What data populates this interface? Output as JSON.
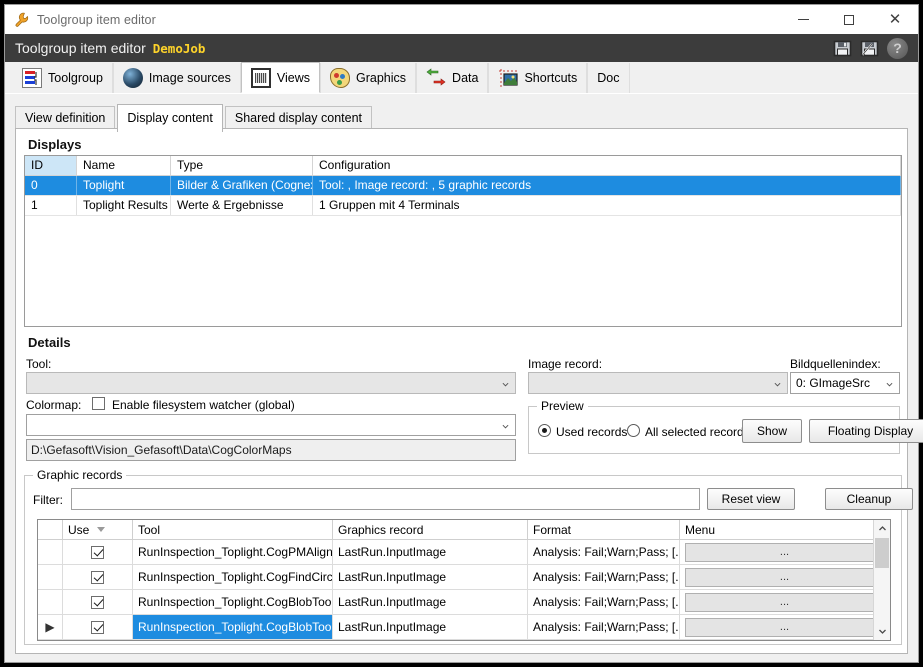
{
  "window": {
    "title": "Toolgroup item editor",
    "icon": "wrench-icon",
    "minimize_label": "Minimize",
    "maximize_label": "Maximize",
    "close_label": "Close"
  },
  "header": {
    "title": "Toolgroup item editor",
    "job_name": "DemoJob",
    "icons": [
      "save-icon",
      "save-as-icon",
      "help-icon"
    ],
    "help_glyph": "?",
    "job_color": "#ffd42a",
    "background_color": "#3c3c3c"
  },
  "toolbar": {
    "tabs": [
      {
        "label": "Toolgroup",
        "icon": "toolgroup-icon",
        "active": false
      },
      {
        "label": "Image sources",
        "icon": "image-sources-icon",
        "active": false
      },
      {
        "label": "Views",
        "icon": "views-icon",
        "active": true
      },
      {
        "label": "Graphics",
        "icon": "graphics-icon",
        "active": false
      },
      {
        "label": "Data",
        "icon": "data-icon",
        "active": false
      },
      {
        "label": "Shortcuts",
        "icon": "shortcuts-icon",
        "active": false
      },
      {
        "label": "Doc",
        "icon": "",
        "active": false
      }
    ]
  },
  "subtabs": [
    {
      "label": "View definition",
      "active": false
    },
    {
      "label": "Display content",
      "active": true
    },
    {
      "label": "Shared display content",
      "active": false
    }
  ],
  "displays": {
    "group_title": "Displays",
    "columns": [
      "ID",
      "Name",
      "Type",
      "Configuration"
    ],
    "sorted_column": "ID",
    "rows": [
      {
        "id": "0",
        "name": "Toplight",
        "type": "Bilder & Grafiken (Cognex)",
        "configuration": "Tool: , Image record: , 5 graphic records",
        "selected": true
      },
      {
        "id": "1",
        "name": "Toplight Results",
        "type": "Werte & Ergebnisse",
        "configuration": "1 Gruppen mit 4 Terminals",
        "selected": false
      }
    ]
  },
  "details": {
    "group_title": "Details",
    "tool_label": "Tool:",
    "tool_value": "",
    "image_record_label": "Image record:",
    "image_record_value": "",
    "bildquellenindex_label": "Bildquellenindex:",
    "bildquellenindex_value": "0: GImageSrc",
    "colormap_label": "Colormap:",
    "colormap_value": "",
    "filesystem_watcher_label": "Enable filesystem watcher (global)",
    "filesystem_watcher_checked": false,
    "colormap_path": "D:\\Gefasoft\\Vision_Gefasoft\\Data\\CogColorMaps",
    "preview": {
      "legend": "Preview",
      "option_used_records": "Used records",
      "option_all_selected_records": "All selected records",
      "selected_option": "Used records",
      "show_button": "Show",
      "floating_display_button": "Floating Display"
    }
  },
  "graphic_records": {
    "legend": "Graphic records",
    "filter_label": "Filter:",
    "filter_value": "",
    "filter_placeholder": "",
    "reset_view_button": "Reset view",
    "cleanup_button": "Cleanup",
    "columns": [
      "",
      "Use",
      "Tool",
      "Graphics record",
      "Format",
      "Menu"
    ],
    "sort_column": "Use",
    "menu_cell_label": "...",
    "rows": [
      {
        "marker": "",
        "use": true,
        "tool": "RunInspection_Toplight.CogPMAlignT...",
        "graphics_record": "LastRun.InputImage",
        "format": "Analysis: Fail;Warn;Pass; [...",
        "menu": "...",
        "selected": false
      },
      {
        "marker": "",
        "use": true,
        "tool": "RunInspection_Toplight.CogFindCircle...",
        "graphics_record": "LastRun.InputImage",
        "format": "Analysis: Fail;Warn;Pass; [...",
        "menu": "...",
        "selected": false
      },
      {
        "marker": "",
        "use": true,
        "tool": "RunInspection_Toplight.CogBlobTool_I...",
        "graphics_record": "LastRun.InputImage",
        "format": "Analysis: Fail;Warn;Pass; [...",
        "menu": "...",
        "selected": false
      },
      {
        "marker": "▶",
        "use": true,
        "tool": "RunInspection_Toplight.CogBlobTool_I...",
        "graphics_record": "LastRun.InputImage",
        "format": "Analysis: Fail;Warn;Pass; [...",
        "menu": "...",
        "selected": true
      }
    ],
    "scroll_up_glyph": "⌃",
    "scroll_down_glyph": "⌄"
  },
  "colors": {
    "selection_blue": "#1e8ce0",
    "header_dark": "#3c3c3c",
    "accent_yellow": "#ffd42a",
    "window_bg": "#f0f0f0"
  }
}
